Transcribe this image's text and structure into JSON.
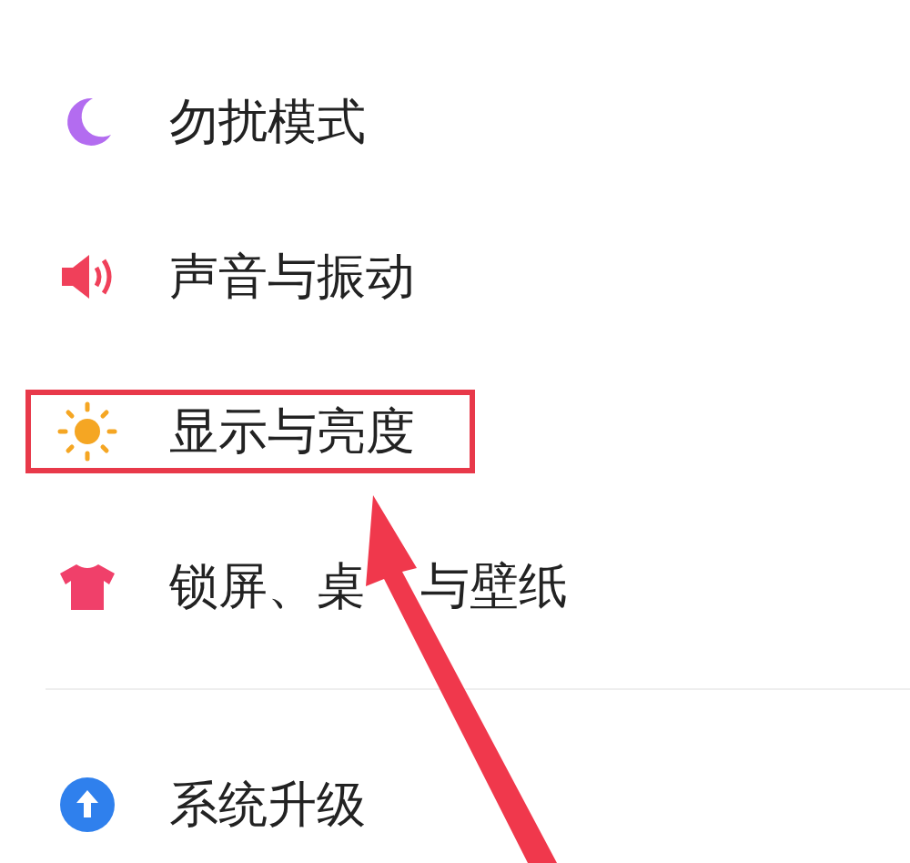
{
  "settings": {
    "items": [
      {
        "kind": "moon",
        "label": "勿扰模式",
        "highlighted": false,
        "divider_before": false
      },
      {
        "kind": "speaker",
        "label": "声音与振动",
        "highlighted": false,
        "divider_before": false
      },
      {
        "kind": "sun",
        "label": "显示与亮度",
        "highlighted": true,
        "divider_before": false
      },
      {
        "kind": "shirt",
        "label": "锁屏、桌",
        "label_after_arrow": "与壁纸",
        "highlighted": false,
        "divider_before": false
      },
      {
        "kind": "upgrade",
        "label": "系统升级",
        "highlighted": false,
        "divider_before": true
      }
    ]
  }
}
